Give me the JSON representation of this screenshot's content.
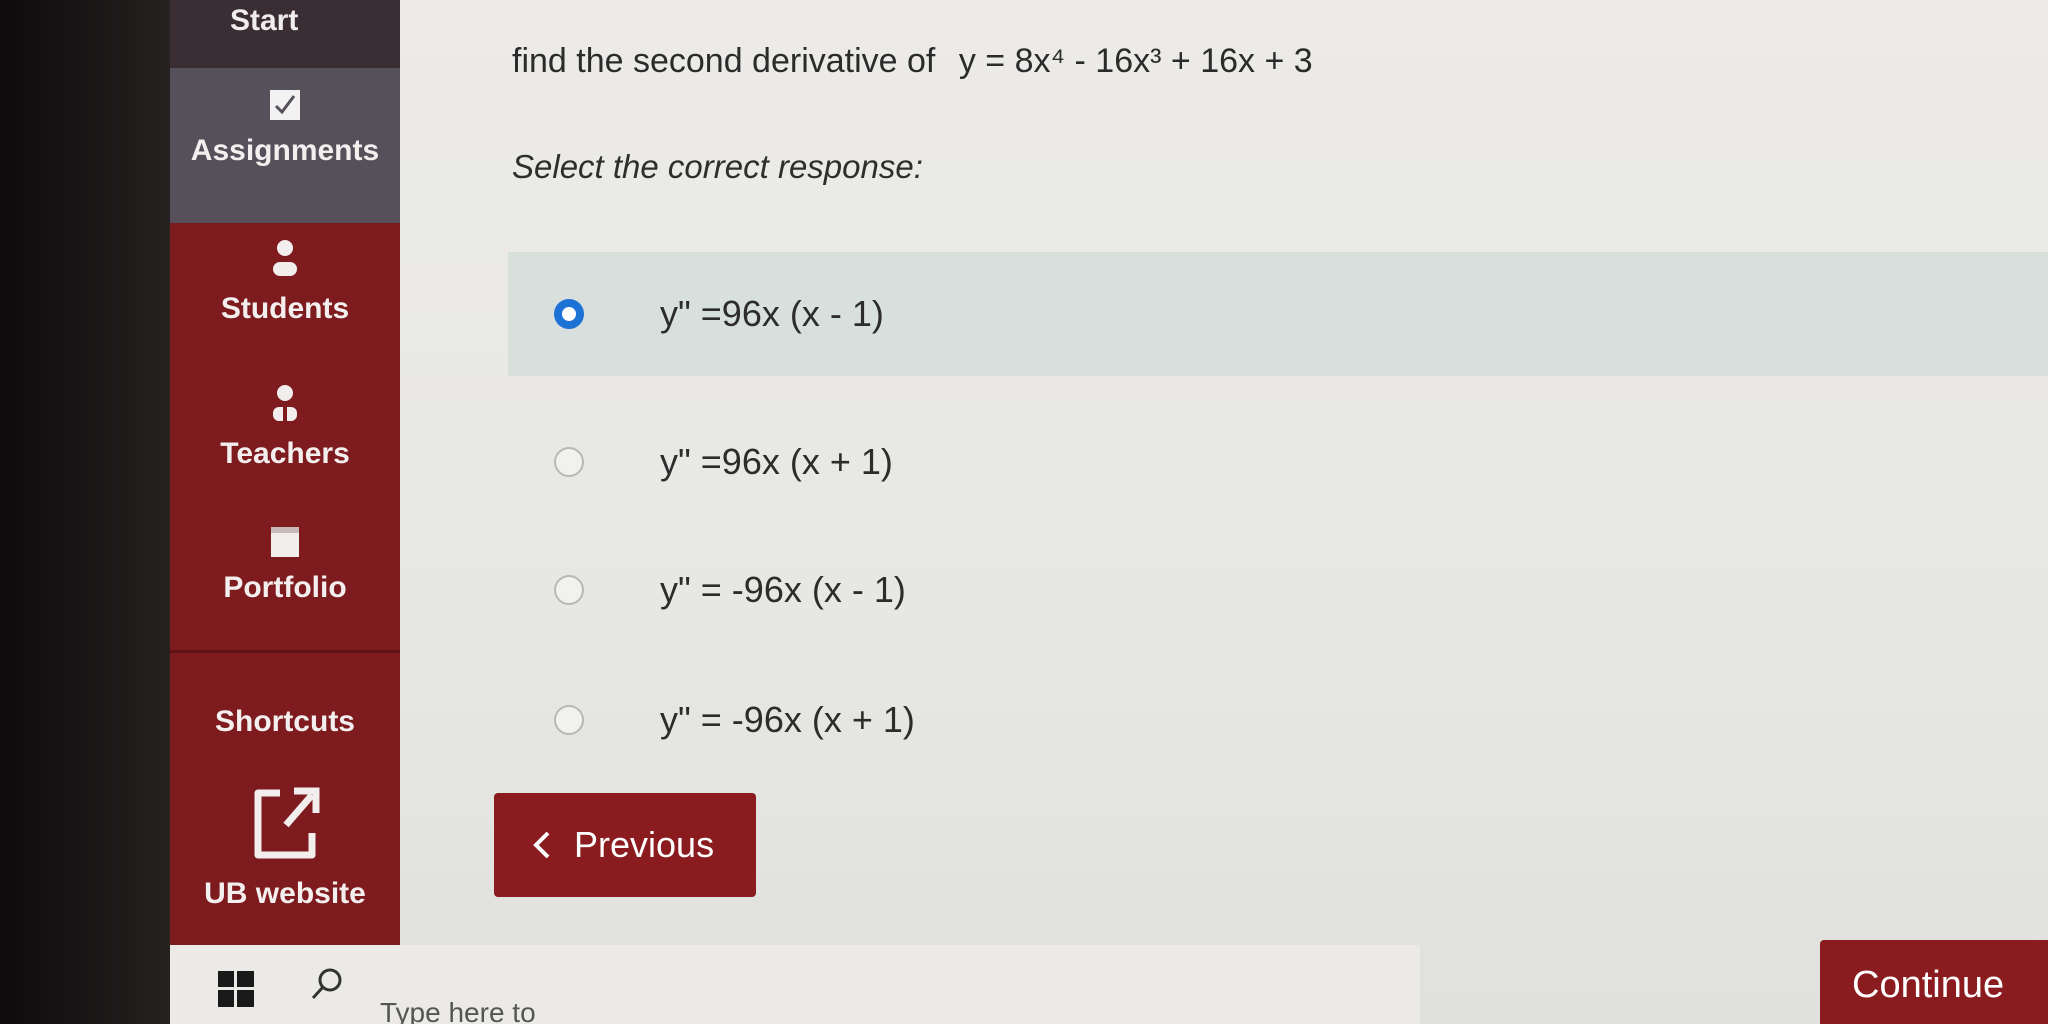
{
  "sidebar": {
    "start_label": "Start",
    "items": [
      {
        "label": "Assignments",
        "icon": "checkbox-icon"
      },
      {
        "label": "Students",
        "icon": "person-icon"
      },
      {
        "label": "Teachers",
        "icon": "teacher-icon"
      },
      {
        "label": "Portfolio",
        "icon": "portfolio-icon"
      },
      {
        "label": "Shortcuts"
      },
      {
        "label": "UB website",
        "icon": "external-link-icon"
      }
    ]
  },
  "question": {
    "prompt": "find the second derivative of",
    "equation": "y = 8x⁴ - 16x³ + 16x + 3",
    "instruction": "Select the correct response:"
  },
  "options": [
    {
      "text": "y\" =96x (x - 1)",
      "selected": true
    },
    {
      "text": "y\" =96x (x + 1)",
      "selected": false
    },
    {
      "text": "y\" = -96x (x - 1)",
      "selected": false
    },
    {
      "text": "y\" = -96x (x + 1)",
      "selected": false
    }
  ],
  "buttons": {
    "previous": "Previous",
    "continue": "Continue"
  },
  "taskbar": {
    "search_placeholder": "Type here to"
  },
  "colors": {
    "sidebar": "#7d1b1e",
    "button": "#8a1b1f",
    "radio_selected": "#1d72d6"
  }
}
